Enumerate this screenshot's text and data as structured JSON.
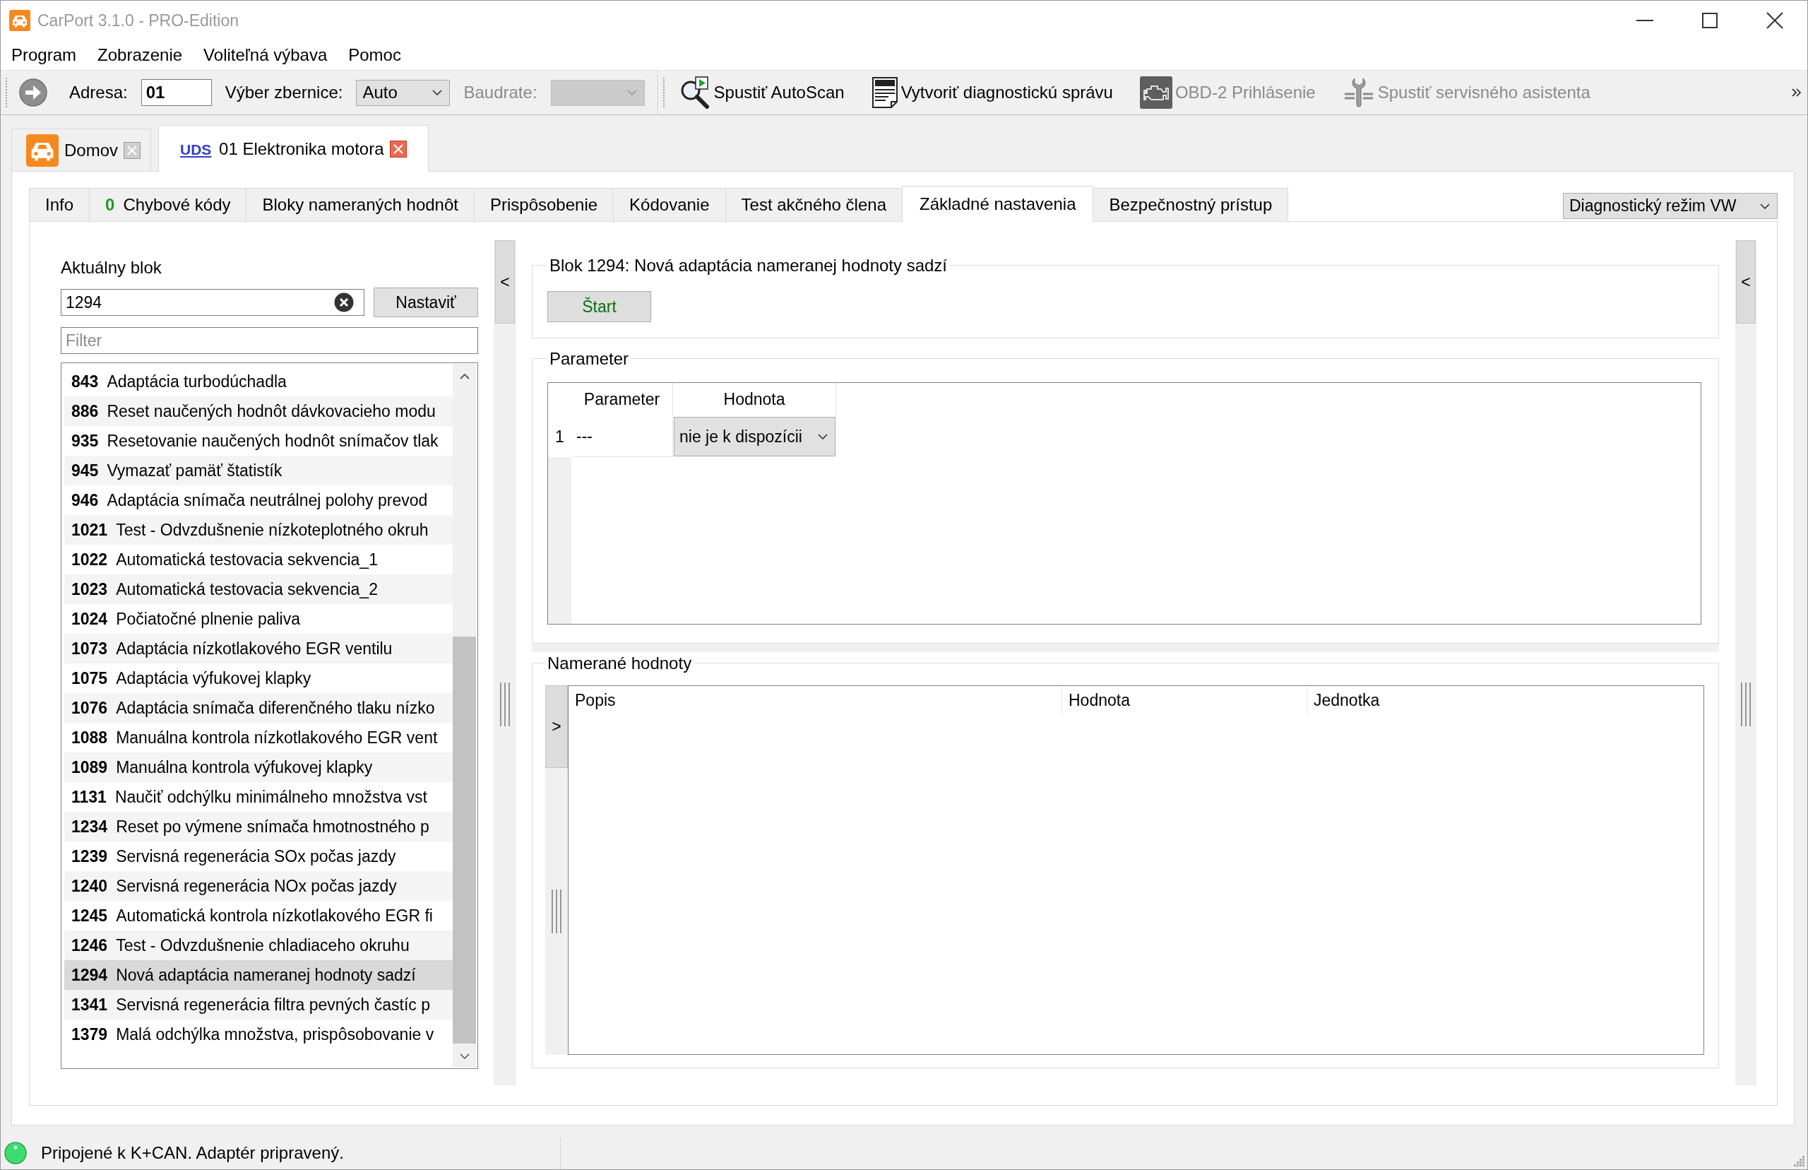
{
  "window": {
    "title": "CarPort 3.1.0 - PRO-Edition"
  },
  "menu": [
    "Program",
    "Zobrazenie",
    "Voliteľná výbava",
    "Pomoc"
  ],
  "toolbar": {
    "address": {
      "label": "Adresa:",
      "value": "01"
    },
    "bus": {
      "label": "Výber zbernice:",
      "value": "Auto"
    },
    "baudrate": {
      "label": "Baudrate:",
      "disabled": true
    },
    "tools": [
      {
        "kind": "scan",
        "label": "Spustiť AutoScan",
        "disabled": false
      },
      {
        "kind": "report",
        "label": "Vytvoriť diagnostickú správu",
        "disabled": false
      },
      {
        "kind": "engine",
        "label": "OBD-2 Prihlásenie",
        "disabled": true
      },
      {
        "kind": "service",
        "label": "Spustiť servisného asistenta",
        "disabled": true
      }
    ]
  },
  "document_tabs": [
    {
      "kind": "home",
      "label": "Domov",
      "selected": false
    },
    {
      "kind": "module",
      "badge": "UDS",
      "label": "01 Elektronika motora",
      "selected": true
    }
  ],
  "module_tabs": [
    {
      "label": "Info",
      "selected": false
    },
    {
      "count": "0",
      "label": "Chybové kódy",
      "selected": false
    },
    {
      "label": "Bloky nameraných hodnôt",
      "selected": false
    },
    {
      "label": "Prispôsobenie",
      "selected": false
    },
    {
      "label": "Kódovanie",
      "selected": false
    },
    {
      "label": "Test akčného člena",
      "selected": false
    },
    {
      "label": "Základné nastavenia",
      "selected": true
    },
    {
      "label": "Bezpečnostný prístup",
      "selected": false
    }
  ],
  "diagnostic_mode": {
    "value": "Diagnostický režim VW"
  },
  "block_selector": {
    "label": "Aktuálny blok",
    "value": "1294",
    "button": "Nastaviť",
    "filter": {
      "placeholder": "Filter"
    },
    "blocks": [
      {
        "number": "843",
        "name": "Adaptácia turbodúchadla",
        "selected": false
      },
      {
        "number": "886",
        "name": "Reset naučených hodnôt dávkovacieho modu",
        "selected": false
      },
      {
        "number": "935",
        "name": "Resetovanie naučených hodnôt snímačov tlak",
        "selected": false
      },
      {
        "number": "945",
        "name": "Vymazať pamäť štatistík",
        "selected": false
      },
      {
        "number": "946",
        "name": "Adaptácia snímača neutrálnej polohy prevod",
        "selected": false
      },
      {
        "number": "1021",
        "name": "Test - Odvzdušnenie nízkoteplotného okruh",
        "selected": false
      },
      {
        "number": "1022",
        "name": "Automatická testovacia sekvencia_1",
        "selected": false
      },
      {
        "number": "1023",
        "name": "Automatická testovacia sekvencia_2",
        "selected": false
      },
      {
        "number": "1024",
        "name": "Počiatočné plnenie paliva",
        "selected": false
      },
      {
        "number": "1073",
        "name": "Adaptácia nízkotlakového EGR ventilu",
        "selected": false
      },
      {
        "number": "1075",
        "name": "Adaptácia výfukovej klapky",
        "selected": false
      },
      {
        "number": "1076",
        "name": "Adaptácia snímača diferenčného tlaku nízko",
        "selected": false
      },
      {
        "number": "1088",
        "name": "Manuálna kontrola nízkotlakového EGR vent",
        "selected": false
      },
      {
        "number": "1089",
        "name": "Manuálna kontrola výfukovej klapky",
        "selected": false
      },
      {
        "number": "1131",
        "name": "Naučiť odchýlku minimálneho množstva vst",
        "selected": false
      },
      {
        "number": "1234",
        "name": "Reset po výmene snímača hmotnostného p",
        "selected": false
      },
      {
        "number": "1239",
        "name": "Servisná regenerácia SOx počas jazdy",
        "selected": false
      },
      {
        "number": "1240",
        "name": "Servisná regenerácia NOx počas jazdy",
        "selected": false
      },
      {
        "number": "1245",
        "name": "Automatická kontrola nízkotlakového EGR fi",
        "selected": false
      },
      {
        "number": "1246",
        "name": "Test - Odvzdušnenie chladiaceho okruhu",
        "selected": false
      },
      {
        "number": "1294",
        "name": "Nová adaptácia nameranej hodnoty sadzí",
        "selected": true
      },
      {
        "number": "1341",
        "name": "Servisná regenerácia filtra pevných častíc p",
        "selected": false
      },
      {
        "number": "1379",
        "name": "Malá odchýlka množstva, prispôsobovanie v",
        "selected": false
      }
    ]
  },
  "left_splitter": {
    "button": "<"
  },
  "block_panel": {
    "title": "Blok 1294: Nová adaptácia nameranej hodnoty sadzí",
    "button": "Štart"
  },
  "parameters": {
    "title": "Parameter",
    "columns": [
      "Parameter",
      "Hodnota"
    ],
    "rows": [
      {
        "index": "1",
        "parameter": "---",
        "value": "nie je k dispozícii"
      }
    ]
  },
  "measured_values": {
    "title": "Namerané hodnoty",
    "side_button": ">",
    "columns": [
      "Popis",
      "Hodnota",
      "Jednotka"
    ]
  },
  "right_splitter": {
    "button": "<"
  },
  "status_bar": {
    "connected": true,
    "text": "Pripojené k K+CAN. Adaptér pripravený."
  }
}
